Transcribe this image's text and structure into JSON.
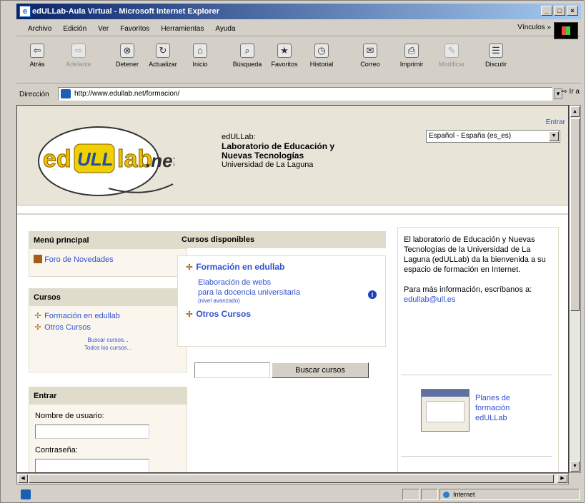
{
  "window": {
    "title": "edULLab-Aula Virtual - Microsoft Internet Explorer",
    "buttons": [
      "_",
      "□",
      "×"
    ]
  },
  "menubar": {
    "items": [
      "Archivo",
      "Edición",
      "Ver",
      "Favoritos",
      "Herramientas",
      "Ayuda"
    ],
    "links_label": "Vínculos"
  },
  "toolbar": {
    "buttons": [
      {
        "label": "Atrás",
        "icon": "back-arrow-icon",
        "glyph": "⇦",
        "enabled": true
      },
      {
        "label": "Adelante",
        "icon": "forward-arrow-icon",
        "glyph": "⇨",
        "enabled": false
      },
      {
        "label": "Detener",
        "icon": "stop-icon",
        "glyph": "⊗",
        "enabled": true
      },
      {
        "label": "Actualizar",
        "icon": "refresh-icon",
        "glyph": "↻",
        "enabled": true
      },
      {
        "label": "Inicio",
        "icon": "home-icon",
        "glyph": "⌂",
        "enabled": true
      },
      {
        "label": "Búsqueda",
        "icon": "search-icon",
        "glyph": "⌕",
        "enabled": true
      },
      {
        "label": "Favoritos",
        "icon": "favorites-icon",
        "glyph": "★",
        "enabled": true
      },
      {
        "label": "Historial",
        "icon": "history-icon",
        "glyph": "◷",
        "enabled": true
      },
      {
        "label": "Correo",
        "icon": "mail-icon",
        "glyph": "✉",
        "enabled": true
      },
      {
        "label": "Imprimir",
        "icon": "print-icon",
        "glyph": "⎙",
        "enabled": true
      },
      {
        "label": "Modificar",
        "icon": "edit-icon",
        "glyph": "✎",
        "enabled": false
      },
      {
        "label": "Discutir",
        "icon": "discuss-icon",
        "glyph": "☰",
        "enabled": true
      }
    ]
  },
  "address": {
    "label": "Dirección",
    "url": "http://www.edullab.net/formacion/",
    "go_label": "Ir a"
  },
  "page": {
    "entrar_link": "Entrar",
    "language": "Español - España (es_es)",
    "tagline": {
      "line1": "edULLab:",
      "line2": "Laboratorio de Educación y",
      "line3": "Nuevas Tecnologías",
      "line4": "Universidad de La Laguna"
    },
    "logo": {
      "text_ed": "ed",
      "text_ull": "ULL",
      "text_lab": "lab",
      "text_net": ".net"
    },
    "main_menu": {
      "title": "Menú principal",
      "items": [
        "Foro de Novedades"
      ]
    },
    "courses": {
      "title": "Cursos",
      "items": [
        "Formación en edullab",
        "Otros Cursos"
      ],
      "search_link": "Buscar cursos...",
      "all_link": "Todos los cursos..."
    },
    "login": {
      "title": "Entrar",
      "username_label": "Nombre de usuario:",
      "password_label": "Contraseña:"
    },
    "available": {
      "title": "Cursos disponibles",
      "category1": "Formación en edullab",
      "course_line1": "Elaboración de webs",
      "course_line2": "para la docencia universitaria",
      "course_note": "(nivel avanzado)",
      "category2": "Otros Cursos",
      "search_button": "Buscar cursos"
    },
    "welcome": {
      "text": "El laboratorio de Educación y Nuevas Tecnologías de la Universidad de La Laguna (edULLab) da la bienvenida a su espacio de formación en Internet.",
      "more_info": "Para más información, escríbanos a:",
      "email": "edullab@ull.es",
      "plans_line1": "Planes de",
      "plans_line2": "formación",
      "plans_line3": "edULLab"
    }
  },
  "status": {
    "zone": "Internet"
  },
  "colors": {
    "title_gradient_start": "#0a246a",
    "link": "#3050d0",
    "header_bg": "#e8e4d8"
  }
}
